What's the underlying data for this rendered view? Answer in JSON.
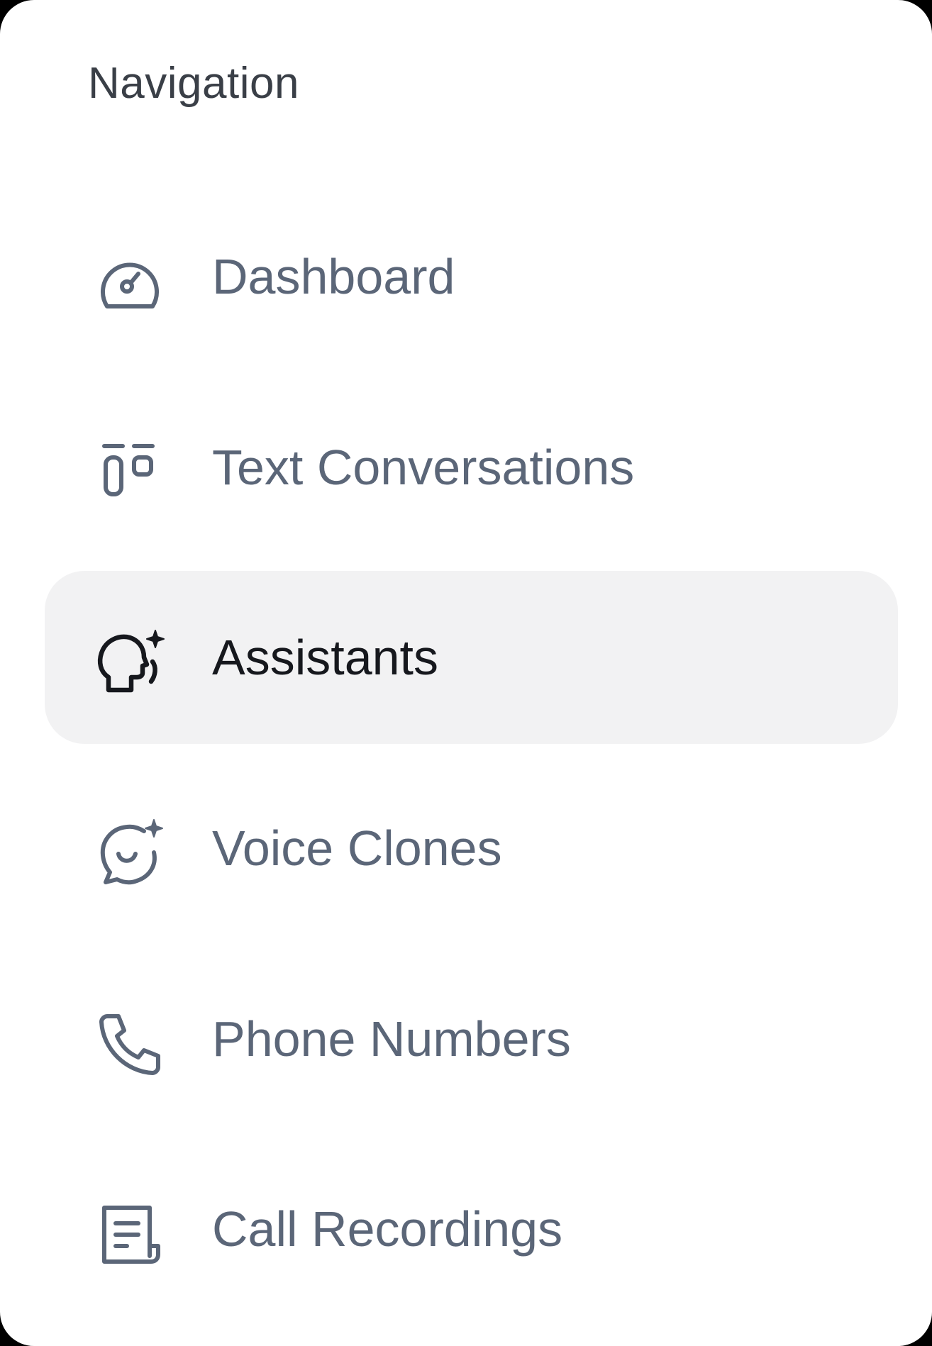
{
  "sidebar": {
    "heading": "Navigation",
    "active_item": "Assistants",
    "colors": {
      "label_default": "#5b6678",
      "label_active": "#16181d",
      "active_background": "#f2f2f3",
      "heading": "#3a3f47"
    },
    "items": [
      {
        "label": "Dashboard",
        "icon": "dashboard-gauge-icon"
      },
      {
        "label": "Text Conversations",
        "icon": "text-conversations-icon"
      },
      {
        "label": "Assistants",
        "icon": "assistant-head-sparkle-icon"
      },
      {
        "label": "Voice Clones",
        "icon": "voice-clone-chat-sparkle-icon"
      },
      {
        "label": "Phone Numbers",
        "icon": "phone-icon"
      },
      {
        "label": "Call Recordings",
        "icon": "document-receipt-icon"
      }
    ]
  }
}
